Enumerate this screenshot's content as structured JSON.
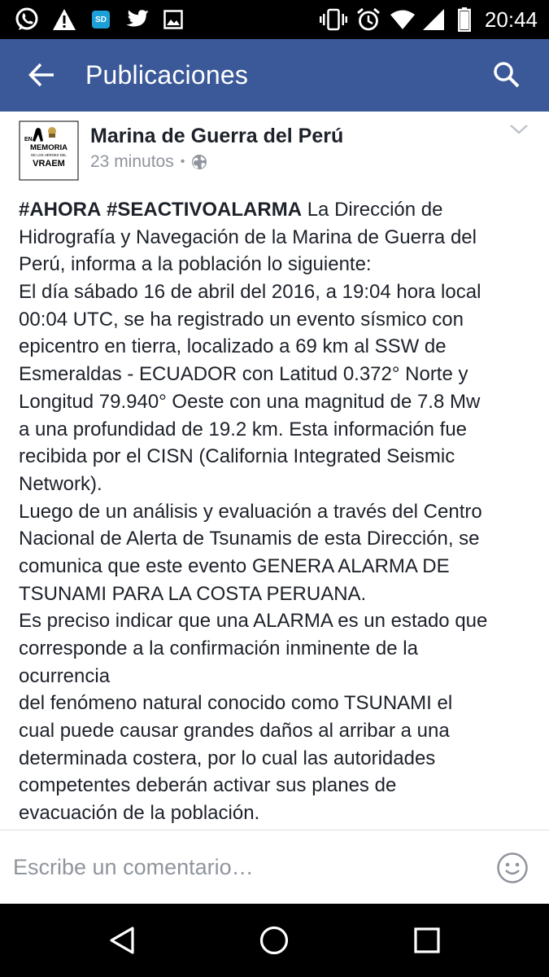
{
  "status_bar": {
    "time": "20:44",
    "sd_badge": "SD",
    "left_icons": [
      "whatsapp-icon",
      "alert-icon",
      "sd-card-icon",
      "twitter-icon",
      "image-icon"
    ],
    "right_icons": [
      "vibrate-icon",
      "alarm-icon",
      "wifi-icon",
      "signal-icon",
      "battery-icon"
    ]
  },
  "app_bar": {
    "title": "Publicaciones",
    "color": "#3b5998"
  },
  "post": {
    "page_name": "Marina de Guerra del Perú",
    "timestamp": "23 minutos",
    "separator": "•",
    "privacy": "public-globe-icon",
    "avatar": {
      "text_en": "EN",
      "text_memoria": "MEMORIA",
      "text_small": "DE LOS HÉROES DEL",
      "text_vraem": "VRAEM"
    },
    "body": {
      "hashtags": [
        "#AHORA",
        "#SEACTIVOALARMA"
      ],
      "line1_rest": " La Dirección de",
      "lines": [
        "Hidrografía y Navegación de la Marina de Guerra del",
        "Perú, informa a la población lo siguiente:",
        "El día sábado 16 de abril del 2016, a 19:04 hora local",
        "00:04 UTC, se ha registrado un evento sísmico con",
        "epicentro en tierra, localizado a 69 km al SSW de",
        "Esmeraldas - ECUADOR con Latitud 0.372° Norte y",
        "Longitud 79.940° Oeste con una magnitud de 7.8 Mw",
        "a una profundidad de 19.2 km. Esta información fue",
        "recibida por el CISN (California Integrated Seismic",
        "Network).",
        "Luego de un análisis y evaluación a través del Centro",
        "Nacional de Alerta de Tsunamis de esta Dirección, se",
        "comunica que este evento GENERA ALARMA DE",
        "TSUNAMI PARA LA COSTA PERUANA.",
        "Es preciso indicar que una ALARMA es un estado que",
        "corresponde a la confirmación inminente de la",
        "ocurrencia",
        "del fenómeno natural conocido como TSUNAMI el",
        "cual puede causar grandes daños al arribar a una",
        "determinada costera, por lo cual las autoridades",
        "competentes deberán activar sus planes de",
        "evacuación de la población."
      ]
    }
  },
  "comment_bar": {
    "placeholder": "Escribe un comentario…"
  },
  "nav_bar": {
    "buttons": [
      "back-triangle-icon",
      "home-circle-icon",
      "recents-square-icon"
    ]
  }
}
